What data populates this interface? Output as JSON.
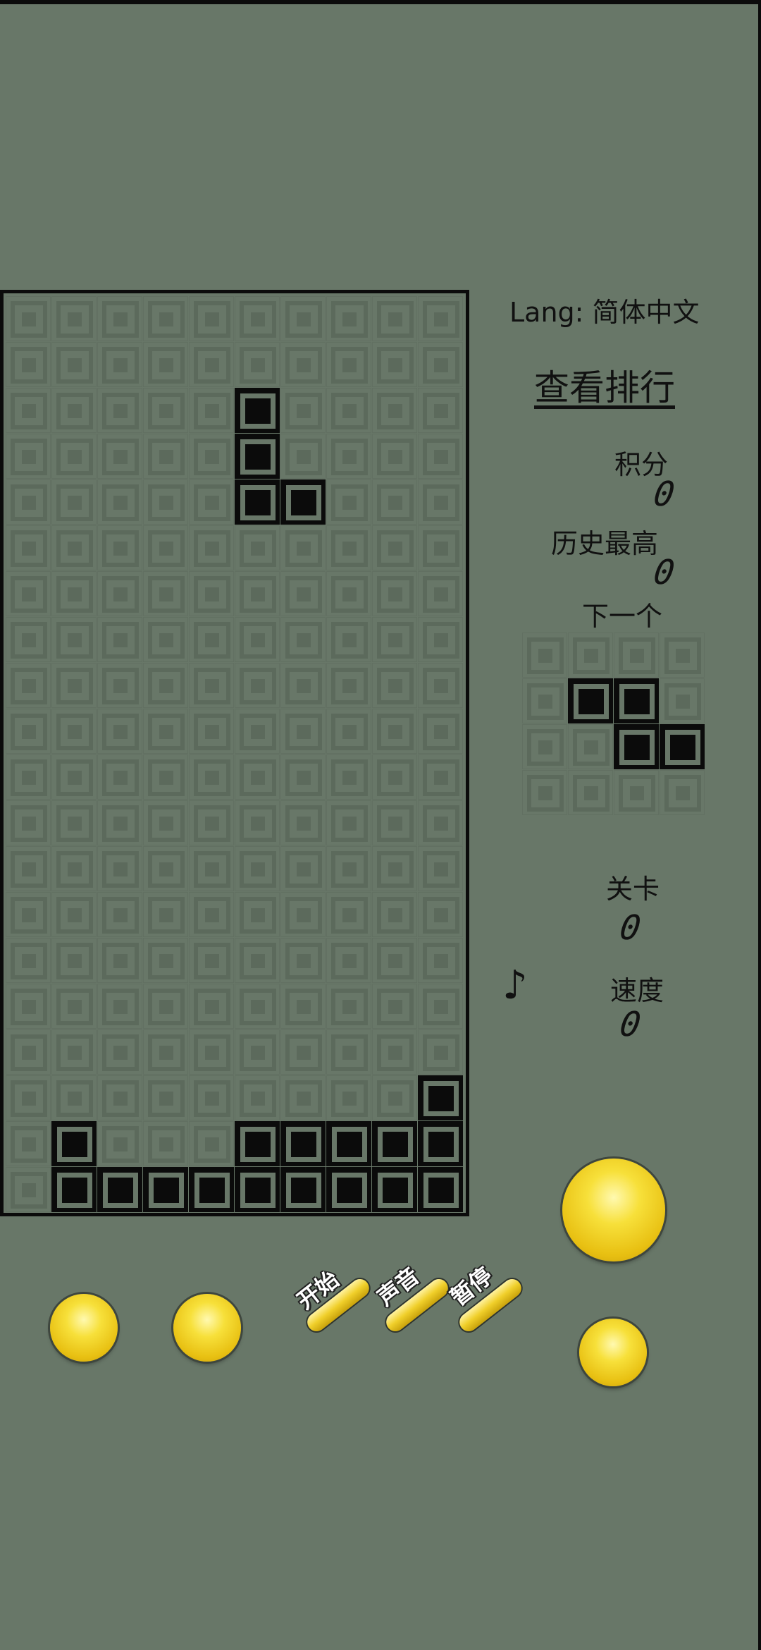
{
  "header": {
    "lang_label": "Lang: 简体中文",
    "rank_link": "查看排行"
  },
  "stats": {
    "score_label": "积分",
    "score": "0",
    "high_label": "历史最高",
    "high": "0",
    "next_label": "下一个",
    "level_label": "关卡",
    "level": "0",
    "speed_label": "速度",
    "speed": "0",
    "music_symbol": "♪"
  },
  "board": {
    "cols": 10,
    "rows": 20,
    "filled": [
      [
        2,
        5
      ],
      [
        3,
        5
      ],
      [
        4,
        5
      ],
      [
        4,
        6
      ],
      [
        17,
        9
      ],
      [
        18,
        1
      ],
      [
        18,
        5
      ],
      [
        18,
        6
      ],
      [
        18,
        7
      ],
      [
        18,
        8
      ],
      [
        18,
        9
      ],
      [
        19,
        1
      ],
      [
        19,
        2
      ],
      [
        19,
        3
      ],
      [
        19,
        4
      ],
      [
        19,
        5
      ],
      [
        19,
        6
      ],
      [
        19,
        7
      ],
      [
        19,
        8
      ],
      [
        19,
        9
      ]
    ]
  },
  "next_piece": {
    "cols": 4,
    "rows": 4,
    "filled": [
      [
        1,
        1
      ],
      [
        1,
        2
      ],
      [
        2,
        2
      ],
      [
        2,
        3
      ]
    ]
  },
  "controls": {
    "start_label": "开始",
    "sound_label": "声音",
    "pause_label": "暂停"
  }
}
